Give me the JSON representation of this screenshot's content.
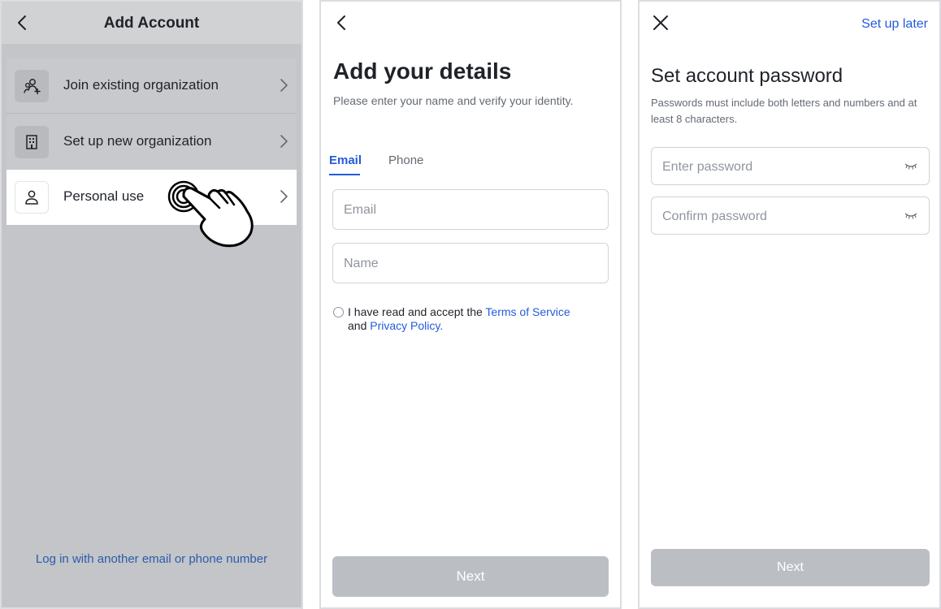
{
  "panel1": {
    "title": "Add Account",
    "items": [
      {
        "label": "Join existing organization",
        "icon": "add-people-icon"
      },
      {
        "label": "Set up new organization",
        "icon": "building-icon"
      },
      {
        "label": "Personal use",
        "icon": "person-icon"
      }
    ],
    "bottom_link": "Log in with another email or phone number"
  },
  "panel2": {
    "title": "Add your details",
    "subtitle": "Please enter your name and verify your identity.",
    "tabs": [
      "Email",
      "Phone"
    ],
    "email_placeholder": "Email",
    "name_placeholder": "Name",
    "terms": {
      "prefix": "I have read and accept the ",
      "terms_link": "Terms of Service",
      "middle": "and ",
      "privacy_link": "Privacy Policy",
      "suffix": "."
    },
    "next_label": "Next"
  },
  "panel3": {
    "later_label": "Set up later",
    "title": "Set account password",
    "subtitle": "Passwords must include both letters and numbers and at least 8 characters.",
    "password_placeholder": "Enter password",
    "confirm_placeholder": "Confirm password",
    "next_label": "Next"
  },
  "colors": {
    "accent": "#245bdb",
    "disabled_button": "#bbbfc4",
    "overlay": "#c3c5c8"
  }
}
